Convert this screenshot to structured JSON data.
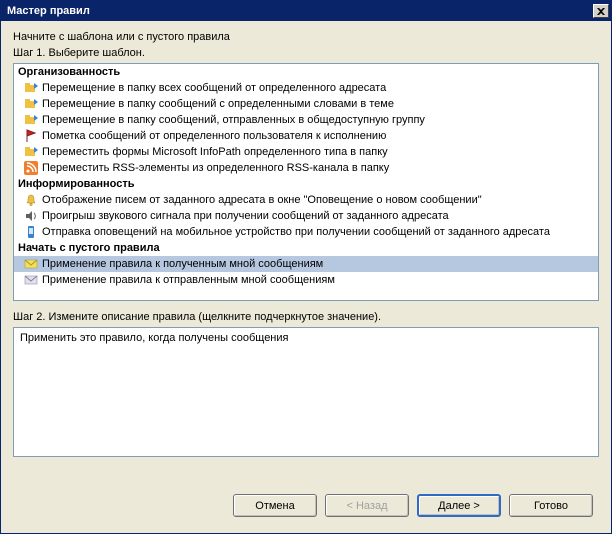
{
  "window": {
    "title": "Мастер правил"
  },
  "intro": "Начните с шаблона или с пустого правила",
  "step1_label": "Шаг 1. Выберите шаблон.",
  "sections": {
    "org": {
      "header": "Организованность",
      "items": [
        "Перемещение в папку всех сообщений от определенного адресата",
        "Перемещение в папку сообщений с определенными словами в теме",
        "Перемещение в папку сообщений, отправленных в общедоступную группу",
        "Пометка сообщений от определенного пользователя к исполнению",
        "Переместить формы Microsoft InfoPath определенного типа в папку",
        "Переместить RSS-элементы из определенного RSS-канала в папку"
      ]
    },
    "info": {
      "header": "Информированность",
      "items": [
        "Отображение писем от заданного адресата в окне \"Оповещение о новом сообщении\"",
        "Проигрыш звукового сигнала при получении сообщений от заданного адресата",
        "Отправка оповещений на мобильное устройство при получении сообщений от заданного адресата"
      ]
    },
    "blank": {
      "header": "Начать с пустого правила",
      "items": [
        "Применение правила к полученным мной сообщениям",
        "Применение правила к отправленным мной сообщениям"
      ]
    }
  },
  "step2_label": "Шаг 2. Измените описание правила (щелкните подчеркнутое значение).",
  "description": "Применить это правило, когда получены сообщения",
  "buttons": {
    "cancel": "Отмена",
    "back": "< Назад",
    "next": "Далее >",
    "finish": "Готово"
  }
}
